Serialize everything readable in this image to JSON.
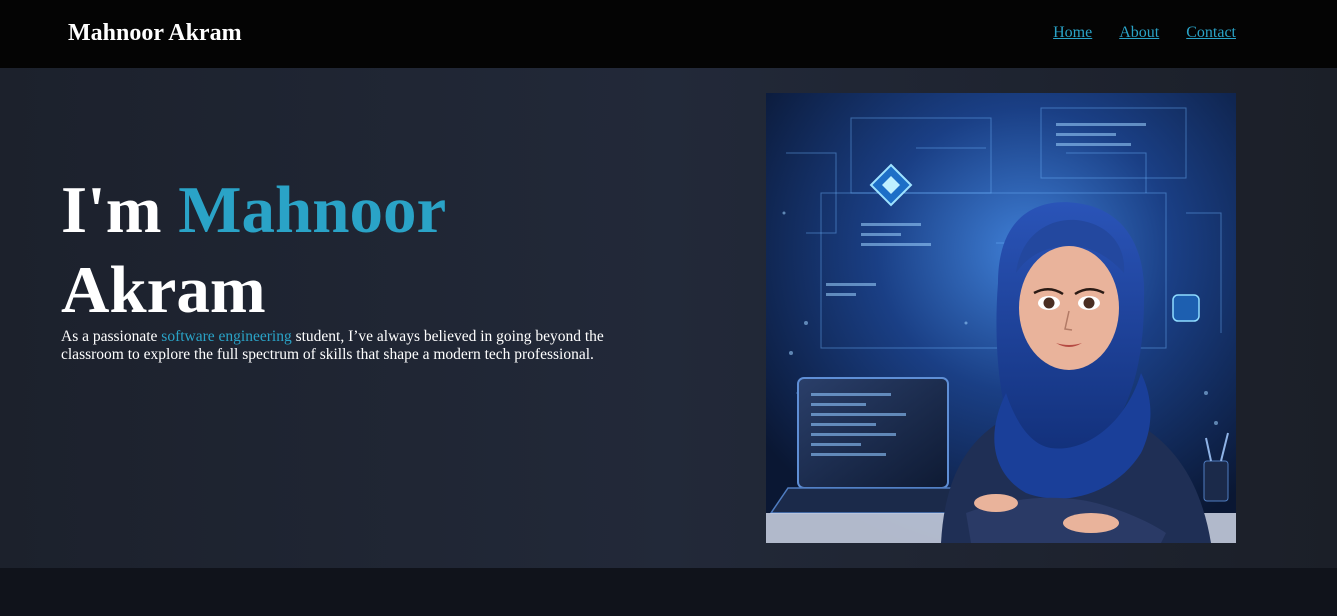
{
  "navbar": {
    "brand": "Mahnoor Akram",
    "links": [
      {
        "label": "Home"
      },
      {
        "label": "About"
      },
      {
        "label": "Contact"
      }
    ]
  },
  "hero": {
    "title_prefix": "I'm ",
    "title_name_accent": "Mahnoor",
    "title_name_rest": "Akram",
    "desc_before": "As a passionate ",
    "desc_highlight": "software engineering",
    "desc_after": " student, I’ve always believed in going beyond the classroom to explore the full spectrum of skills that shape a modern tech professional."
  },
  "colors": {
    "accent": "#2aa3c7",
    "navbar_bg": "#040404",
    "hero_bg": "#222939",
    "text": "#ffffff"
  }
}
